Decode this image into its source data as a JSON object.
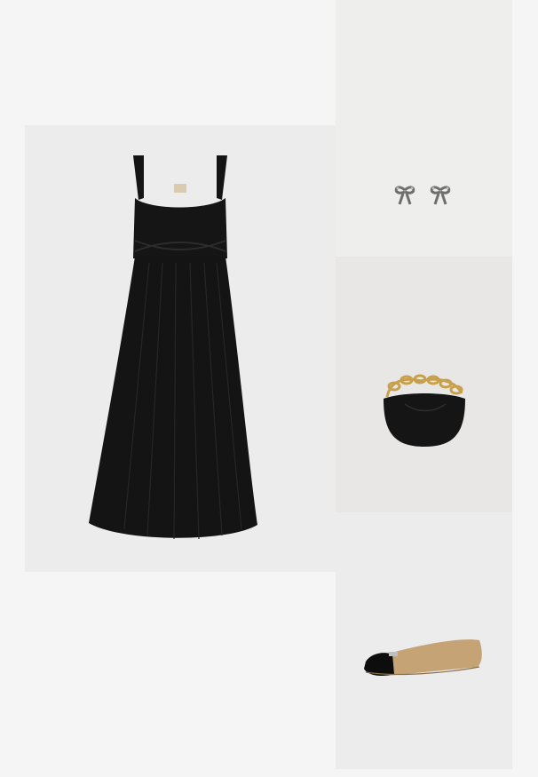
{
  "products": [
    {
      "id": "dress",
      "icon": "black-midi-dress-icon"
    },
    {
      "id": "earrings",
      "icon": "bow-earrings-icon"
    },
    {
      "id": "bag",
      "icon": "chain-handbag-icon"
    },
    {
      "id": "shoe",
      "icon": "cap-toe-ballet-flat-icon"
    }
  ],
  "colors": {
    "background": "#f5f5f5",
    "dress": "#141414",
    "bag": "#151515",
    "chain": "#c9a04a",
    "shoe_body": "#c5a374",
    "shoe_toe": "#0d0d0d"
  }
}
